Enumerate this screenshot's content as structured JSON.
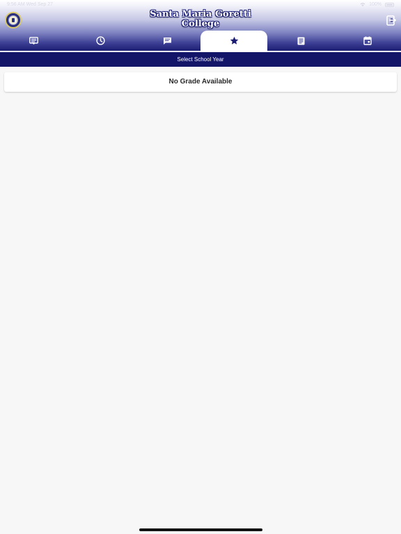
{
  "status_bar": {
    "time_date": "9:56 AM  Wed Sep 27",
    "battery": "100%"
  },
  "header": {
    "title_line1": "Santa Maria Goretti",
    "title_line2": "College"
  },
  "tabs": [
    {
      "icon": "announcement-icon",
      "active": false
    },
    {
      "icon": "clock-icon",
      "active": false
    },
    {
      "icon": "message-icon",
      "active": false
    },
    {
      "icon": "star-icon",
      "active": true
    },
    {
      "icon": "list-icon",
      "active": false
    },
    {
      "icon": "calendar-icon",
      "active": false
    }
  ],
  "school_year": {
    "label": "Select School Year"
  },
  "content": {
    "empty_message": "No Grade Available"
  },
  "colors": {
    "primary_navy": "#131568",
    "background": "#f7f7f7",
    "tab_active_bg": "#ffffff"
  }
}
